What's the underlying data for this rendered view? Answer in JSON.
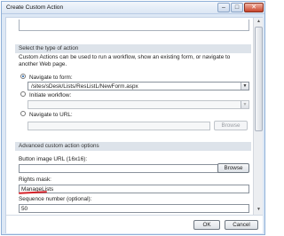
{
  "window": {
    "title": "Create Custom Action"
  },
  "title_buttons": {
    "minimize": "–",
    "maximize": "□",
    "close": "✕"
  },
  "select_action": {
    "header": "Select the type of action",
    "description": "Custom Actions can be used to run a workflow, show an existing form, or navigate to another Web page.",
    "navigate_to_form_label": "Navigate to form:",
    "navigate_to_form_value": "/sites/sDesk/Lists/ResListL/NewForm.aspx",
    "initiate_workflow_label": "Initiate workflow:",
    "initiate_workflow_value": "",
    "navigate_to_url_label": "Navigate to URL:",
    "navigate_to_url_value": "",
    "browse_label": "Browse",
    "selected": "navigate_to_form"
  },
  "advanced": {
    "header": "Advanced custom action options",
    "button_image_label": "Button image URL (16x16):",
    "button_image_value": "",
    "browse_label": "Browse",
    "rights_mask_label": "Rights mask:",
    "rights_mask_value": "ManageLists",
    "sequence_label": "Sequence number (optional):",
    "sequence_value": "50"
  },
  "footer": {
    "ok_label": "OK",
    "cancel_label": "Cancel"
  },
  "colors": {
    "annotation_underline": "#d6232a",
    "section_header_bg": "#dde3ea",
    "radio_dot": "#1c5da6"
  }
}
